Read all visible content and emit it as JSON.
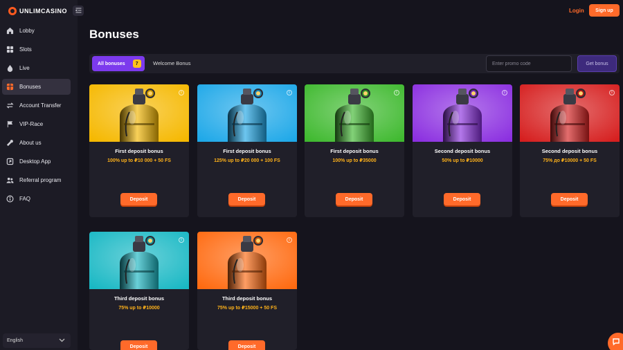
{
  "brand": {
    "name": "unlimcasino",
    "accent": "#ff6a2a"
  },
  "sidebar": {
    "items": [
      {
        "label": "Lobby",
        "icon": "home-icon"
      },
      {
        "label": "Slots",
        "icon": "slots-icon"
      },
      {
        "label": "Live",
        "icon": "live-icon"
      },
      {
        "label": "Bonuses",
        "icon": "gift-icon",
        "active": true
      },
      {
        "label": "Account Transfer",
        "icon": "transfer-icon"
      },
      {
        "label": "VIP-Race",
        "icon": "race-icon"
      },
      {
        "label": "About us",
        "icon": "about-icon"
      },
      {
        "label": "Desktop App",
        "icon": "desktop-icon"
      },
      {
        "label": "Referral program",
        "icon": "referral-icon"
      },
      {
        "label": "FAQ",
        "icon": "info-icon"
      }
    ],
    "language": "English"
  },
  "header": {
    "login_label": "Login",
    "signup_label": "Sign up"
  },
  "page": {
    "title": "Bonuses"
  },
  "filters": {
    "all_label": "All bonuses",
    "all_count": "7",
    "welcome_label": "Welcome Bonus",
    "promo_placeholder": "Enter promo code",
    "get_bonus_label": "Get bonus"
  },
  "cards": [
    {
      "title": "First deposit bonus",
      "subtitle": "100% up to ₽10 000 + 50 FS",
      "button": "Deposit",
      "color": "#f5b800"
    },
    {
      "title": "First deposit bonus",
      "subtitle": "125% up to ₽20 000 + 100 FS",
      "button": "Deposit",
      "color": "#1ea8e8"
    },
    {
      "title": "First deposit bonus",
      "subtitle": "100% up to ₽35000",
      "button": "Deposit",
      "color": "#3fb92f"
    },
    {
      "title": "Second deposit bonus",
      "subtitle": "50% up to ₽10000",
      "button": "Deposit",
      "color": "#8b2fe0"
    },
    {
      "title": "Second deposit bonus",
      "subtitle": "75% до ₽10000 + 50 FS",
      "button": "Deposit",
      "color": "#d61f1f"
    },
    {
      "title": "Third deposit bonus",
      "subtitle": "75% up to ₽10000",
      "button": "Deposit",
      "color": "#19b8c4"
    },
    {
      "title": "Third deposit bonus",
      "subtitle": "75% up to ₽15000 + 50 FS",
      "button": "Deposit",
      "color": "#ff6a10"
    }
  ]
}
